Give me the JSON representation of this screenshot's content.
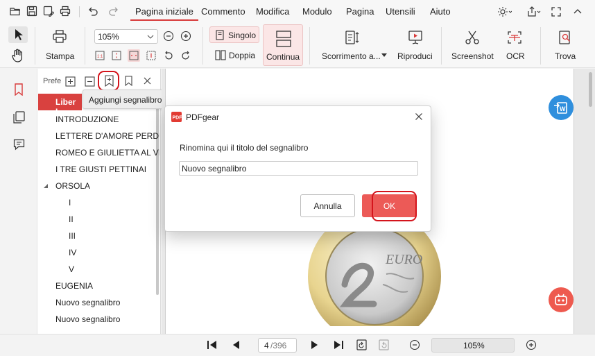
{
  "menu": {
    "tabs": [
      "Pagina iniziale",
      "Commento",
      "Modifica",
      "Modulo",
      "Pagina",
      "Utensili",
      "Aiuto"
    ]
  },
  "ribbon": {
    "print_label": "Stampa",
    "zoom_value": "105%",
    "single_label": "Singolo",
    "double_label": "Doppia",
    "continuous_label": "Continua",
    "scroll_label": "Scorrimento a...",
    "play_label": "Riproduci",
    "screenshot_label": "Screenshot",
    "ocr_label": "OCR",
    "find_label": "Trova"
  },
  "panel": {
    "title_truncated": "Prefe",
    "tooltip": "Aggiungi segnalibro",
    "bookmarks": [
      {
        "label": "Liber L",
        "level": 0,
        "selected": true
      },
      {
        "label": "INTRODUZIONE",
        "level": 0
      },
      {
        "label": "LETTERE D'AMORE PERDUTE",
        "level": 0
      },
      {
        "label": "ROMEO E GIULIETTA AL VILL",
        "level": 0
      },
      {
        "label": "I TRE GIUSTI PETTINAI",
        "level": 0
      },
      {
        "label": "ORSOLA",
        "level": 0,
        "expanded": true
      },
      {
        "label": "I",
        "level": 1
      },
      {
        "label": "II",
        "level": 1
      },
      {
        "label": "III",
        "level": 1
      },
      {
        "label": "IV",
        "level": 1
      },
      {
        "label": "V",
        "level": 1
      },
      {
        "label": "EUGENIA",
        "level": 0
      },
      {
        "label": "Nuovo segnalibro",
        "level": 0
      },
      {
        "label": "Nuovo segnalibro",
        "level": 0
      }
    ]
  },
  "dialog": {
    "app_name": "PDFgear",
    "prompt": "Rinomina qui il titolo del segnalibro",
    "input_value": "Nuovo segnalibro",
    "cancel_label": "Annulla",
    "ok_label": "OK"
  },
  "bottom": {
    "current_page": "4",
    "total_pages": "/396",
    "zoom_value": "105%"
  },
  "colors": {
    "accent": "#d83b3b",
    "selected_bookmark_bg": "#d9413f",
    "ok_button": "#ec5a57",
    "highlight_ring": "#d4141c",
    "convert_badge": "#2f8fdd",
    "assistant_badge": "#ee5a4f"
  }
}
